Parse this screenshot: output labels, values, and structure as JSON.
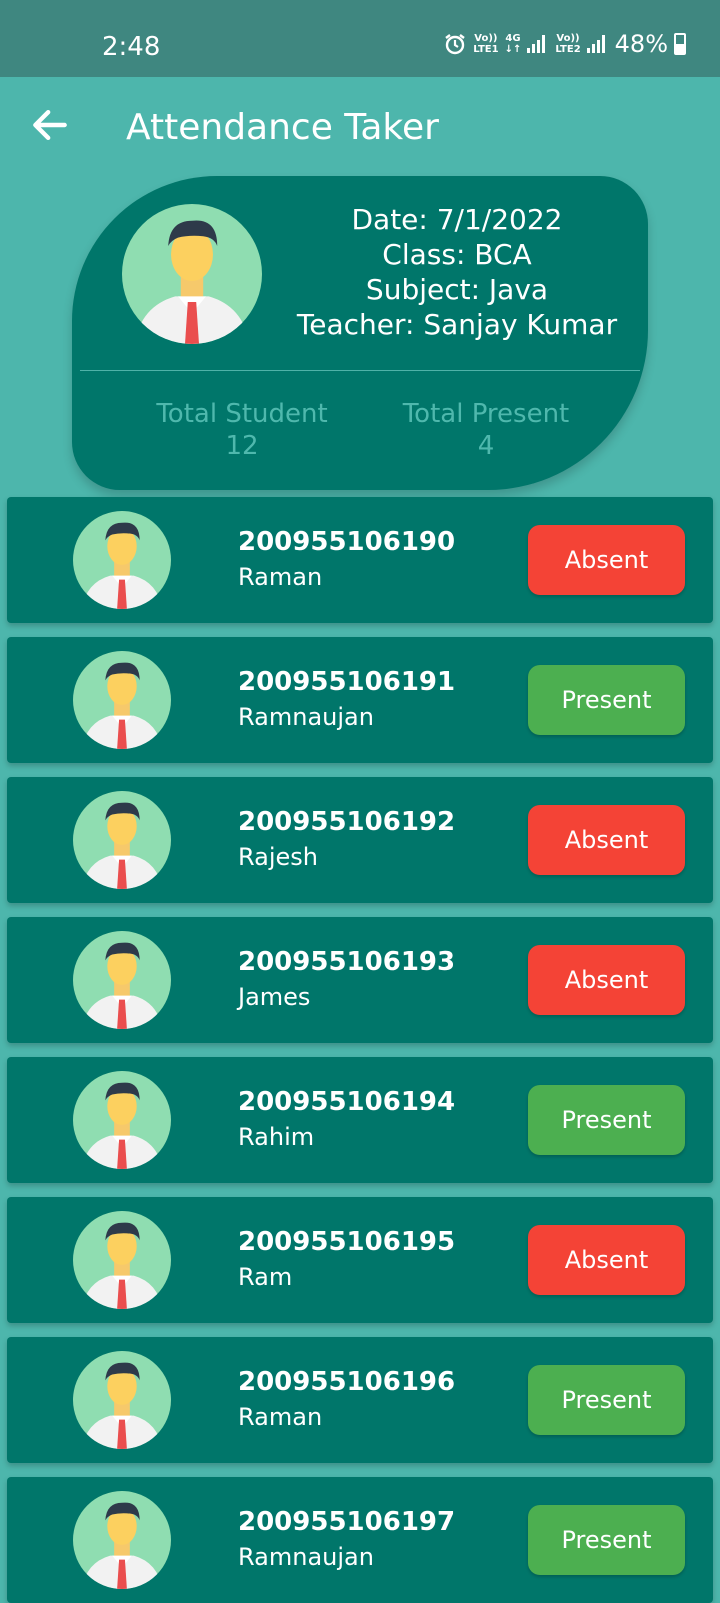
{
  "status_bar": {
    "time": "2:48",
    "sim1": [
      "Vo))",
      "LTE1"
    ],
    "net": [
      "4G",
      "↓↑"
    ],
    "sim2": [
      "Vo))",
      "LTE2"
    ],
    "battery": "48%"
  },
  "app_bar": {
    "title": "Attendance Taker",
    "back_icon": "arrow-back-icon"
  },
  "header": {
    "date": "Date: 7/1/2022",
    "class": "Class: BCA",
    "subject": "Subject: Java",
    "teacher": "Teacher: Sanjay Kumar",
    "total_student_label": "Total Student",
    "total_student_value": "12",
    "total_present_label": "Total Present",
    "total_present_value": "4"
  },
  "students": [
    {
      "roll": "200955106190",
      "name": "Raman",
      "status": "Absent"
    },
    {
      "roll": "200955106191",
      "name": "Ramnaujan",
      "status": "Present"
    },
    {
      "roll": "200955106192",
      "name": "Rajesh",
      "status": "Absent"
    },
    {
      "roll": "200955106193",
      "name": "James",
      "status": "Absent"
    },
    {
      "roll": "200955106194",
      "name": "Rahim",
      "status": "Present"
    },
    {
      "roll": "200955106195",
      "name": "Ram",
      "status": "Absent"
    },
    {
      "roll": "200955106196",
      "name": "Raman",
      "status": "Present"
    },
    {
      "roll": "200955106197",
      "name": "Ramnaujan",
      "status": "Present"
    }
  ],
  "colors": {
    "background": "#4db6ac",
    "card": "#00766a",
    "absent": "#f44336",
    "present": "#4caf50"
  }
}
